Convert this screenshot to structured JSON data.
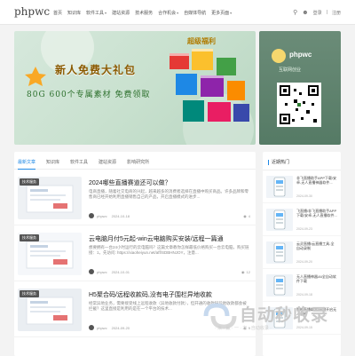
{
  "header": {
    "logo": "phpwc",
    "nav": [
      {
        "label": "首页",
        "caret": false
      },
      {
        "label": "知识库",
        "caret": false
      },
      {
        "label": "软件工具",
        "caret": true
      },
      {
        "label": "建站资源",
        "caret": false
      },
      {
        "label": "技术服务",
        "caret": false
      },
      {
        "label": "合作机会",
        "caret": true
      },
      {
        "label": "自媒体导航",
        "caret": false
      },
      {
        "label": "更多页面",
        "caret": true
      }
    ],
    "login": "登录",
    "register": "注册"
  },
  "hero": {
    "badge": "超级福利",
    "title": "新人免费大礼包",
    "subtitle": "80G 600个专属素材 免费领取",
    "side_brand": "phpwc",
    "side_slogan": "互联网创业"
  },
  "tabs": [
    "最新文章",
    "知识库",
    "软件工具",
    "建站资源",
    "影响研究所"
  ],
  "posts": [
    {
      "tag": "技术服务",
      "title": "2024哪些直播赛道还可以做？",
      "excerpt": "电商直播，随着社交电商的兴起，越来越多的消费者选择在直播中购买商品。许多品牌和零售商已经开始利用直播销售自己的产品，开启直播模式的进步...",
      "author": "phpwc",
      "date": "2024-10-18",
      "views": "4"
    },
    {
      "tag": "技术服务",
      "title": "云电脑月付5元起-win云电脑购买安装/远程一篇通",
      "excerpt": "想要拥有一台24小时运行的云电脑吗？这篇文章教你怎样最低价格购买一台云电脑，购买链接：1，先访问: https://xiaoheiyun.net/aff/SDBHNJOY，注意...",
      "author": "phpwc",
      "date": "2024-10-01",
      "views": "12"
    },
    {
      "tag": "技术服务",
      "title": "H5聚合码/远程收款码,没有电子围栏异地收款",
      "excerpt": "经常异地业务，需要接受线上远程收款（异地收款付款），但开通的收款码异地收款都会被拦截？这里直接是利用的是在一个平台的技术...",
      "author": "phpwc",
      "date": "2024-09-20",
      "views": "9"
    }
  ],
  "sidebar": {
    "heading": "近期热门",
    "items": [
      {
        "title": "非飞直播助手APP下载/安卓-无人直播神器软件...",
        "date": "2024-09-30"
      },
      {
        "title": "飞直播/非飞直播助手APP下载/安卓-无人直播软件...",
        "date": "2024-09-23"
      },
      {
        "title": "云灵直播/云直播工具-全自动录制",
        "date": "2024-09-20"
      },
      {
        "title": "无人直播神器/AI全自动软件下载",
        "date": "2024-09-18"
      },
      {
        "title": "智能直播助手/一键开启无人直播",
        "date": "2024-09-15"
      }
    ]
  },
  "watermark": {
    "text": "自动秒收录",
    "sub": "· 来 · 赢 · 一 · 次 · 自动收录 ·"
  }
}
